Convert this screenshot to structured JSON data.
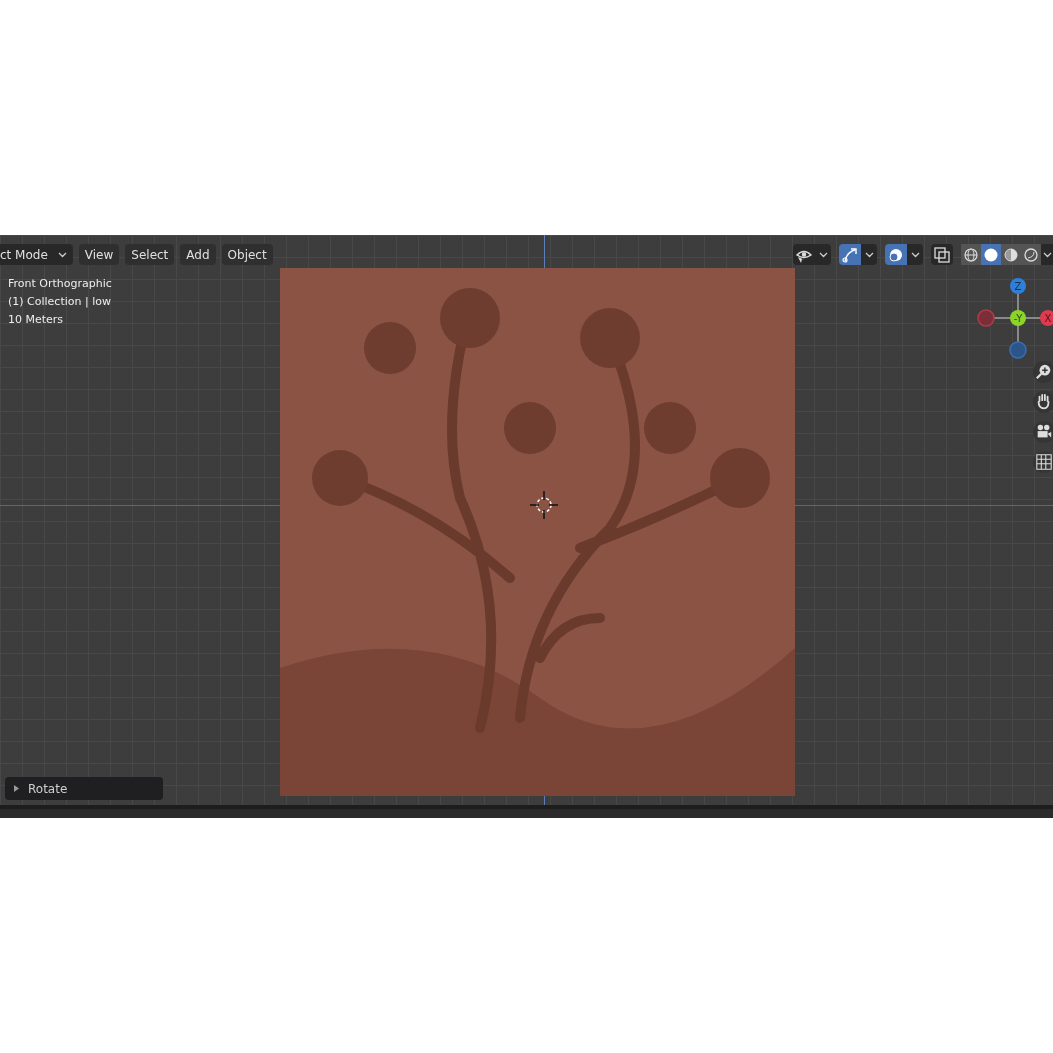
{
  "header": {
    "mode": "ct Mode",
    "menus": [
      "View",
      "Select",
      "Add",
      "Object"
    ],
    "toggles": [
      {
        "kind": "visibility",
        "on": false
      },
      {
        "kind": "gizmo",
        "on": true
      },
      {
        "kind": "overlay",
        "on": true
      },
      {
        "kind": "xray",
        "on": false
      }
    ],
    "shading": [
      {
        "kind": "wireframe",
        "selected": false
      },
      {
        "kind": "solid",
        "selected": true
      },
      {
        "kind": "material",
        "selected": false
      },
      {
        "kind": "rendered",
        "selected": false
      }
    ]
  },
  "viewport_info": [
    "Front Orthographic",
    "(1) Collection | low",
    "10 Meters"
  ],
  "gizmo": {
    "up": "Z",
    "center": "-Y",
    "right": "X"
  },
  "operator_panel": {
    "label": "Rotate",
    "expanded": false
  }
}
